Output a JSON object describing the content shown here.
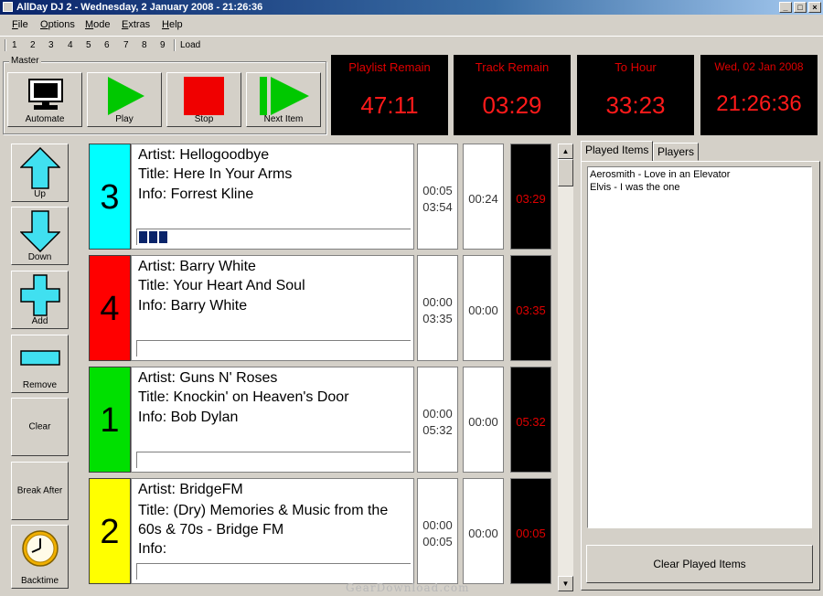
{
  "window": {
    "title": "AllDay DJ 2 - Wednesday, 2 January 2008 - 21:26:36",
    "controls": [
      "_",
      "□",
      "×"
    ]
  },
  "menu": [
    {
      "label": "File",
      "key": "F",
      "rest": "ile"
    },
    {
      "label": "Options",
      "key": "O",
      "rest": "ptions"
    },
    {
      "label": "Mode",
      "key": "M",
      "rest": "ode"
    },
    {
      "label": "Extras",
      "key": "E",
      "rest": "xtras"
    },
    {
      "label": "Help",
      "key": "H",
      "rest": "elp"
    }
  ],
  "toolbar": {
    "numbers": [
      "1",
      "2",
      "3",
      "4",
      "5",
      "6",
      "7",
      "8",
      "9"
    ],
    "load": "Load"
  },
  "master": {
    "label": "Master",
    "buttons": [
      {
        "label": "Automate",
        "icon": "monitor-icon"
      },
      {
        "label": "Play",
        "icon": "play-icon"
      },
      {
        "label": "Stop",
        "icon": "stop-icon"
      },
      {
        "label": "Next Item",
        "icon": "next-icon"
      }
    ]
  },
  "displays": [
    {
      "caption": "Playlist Remain",
      "value": "47:11"
    },
    {
      "caption": "Track Remain",
      "value": "03:29"
    },
    {
      "caption": "To Hour",
      "value": "33:23"
    },
    {
      "caption": "Wed, 02 Jan 2008",
      "value": "21:26:36"
    }
  ],
  "side_buttons": [
    {
      "label": "Up",
      "icon": "arrow-up-icon"
    },
    {
      "label": "Down",
      "icon": "arrow-down-icon"
    },
    {
      "label": "Add",
      "icon": "plus-icon"
    },
    {
      "label": "Remove",
      "icon": "minus-icon"
    },
    {
      "label": "Clear"
    },
    {
      "label": "Break After"
    },
    {
      "label": "Backtime",
      "icon": "clock-icon"
    }
  ],
  "playlist": [
    {
      "number": "3",
      "color": "#00ffff",
      "artist": "Artist: Hellogoodbye",
      "title": "Title: Here In Your Arms",
      "info": "Info: Forrest Kline",
      "pos": "00:05",
      "length": "03:54",
      "intro": "00:24",
      "remain": "03:29",
      "progress": 0.09
    },
    {
      "number": "4",
      "color": "#ff0000",
      "artist": "Artist: Barry White",
      "title": "Title: Your Heart And Soul",
      "info": "Info: Barry White",
      "pos": "00:00",
      "length": "03:35",
      "intro": "00:00",
      "remain": "03:35",
      "progress": 0
    },
    {
      "number": "1",
      "color": "#00e000",
      "artist": "Artist: Guns N' Roses",
      "title": "Title: Knockin' on Heaven's Door",
      "info": "Info: Bob Dylan",
      "pos": "00:00",
      "length": "05:32",
      "intro": "00:00",
      "remain": "05:32",
      "progress": 0
    },
    {
      "number": "2",
      "color": "#ffff00",
      "artist": "Artist: BridgeFM",
      "title": "Title: (Dry) Memories & Music from the 60s & 70s - Bridge FM",
      "info": "Info:",
      "pos": "00:00",
      "length": "00:05",
      "intro": "00:00",
      "remain": "00:05",
      "progress": 0
    }
  ],
  "tabs": [
    "Played Items",
    "Players"
  ],
  "played_items": [
    "Aerosmith - Love in an Elevator",
    "Elvis - I was the one"
  ],
  "clear_played": "Clear Played Items",
  "watermark": "GearDownload.com"
}
